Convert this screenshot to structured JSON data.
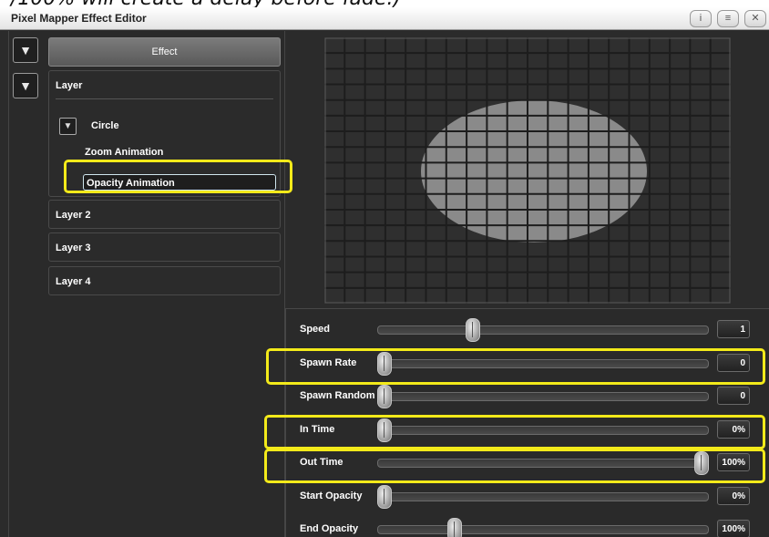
{
  "caption": "/100% will create a delay before fade.)",
  "window": {
    "title": "Pixel Mapper Effect Editor",
    "buttons": {
      "info": "i",
      "menu": "≡",
      "close": "✕"
    }
  },
  "left": {
    "effect_label": "Effect",
    "expanded_layer": {
      "label": "Layer",
      "shape": "Circle",
      "animations": [
        "Zoom Animation",
        "Opacity Animation"
      ],
      "selected_animation": "Opacity Animation"
    },
    "layers": [
      "Layer 2",
      "Layer 3",
      "Layer 4"
    ]
  },
  "controls": [
    {
      "label": "Speed",
      "value": "1",
      "level": 0.28
    },
    {
      "label": "Spawn Rate",
      "value": "0",
      "level": 0.0
    },
    {
      "label": "Spawn Random",
      "value": "0",
      "level": 0.0
    },
    {
      "label": "In Time",
      "value": "0%",
      "level": 0.0
    },
    {
      "label": "Out Time",
      "value": "100%",
      "level": 1.0
    },
    {
      "label": "Start Opacity",
      "value": "0%",
      "level": 0.0
    },
    {
      "label": "End Opacity",
      "value": "100%",
      "level": 0.22
    }
  ],
  "highlighted_controls": [
    "Spawn Rate",
    "In Time",
    "Out Time"
  ],
  "colors": {
    "highlight": "#f3ea1a",
    "panel_bg": "#2b2b2b",
    "shape_fill": "#8a8a8a"
  }
}
